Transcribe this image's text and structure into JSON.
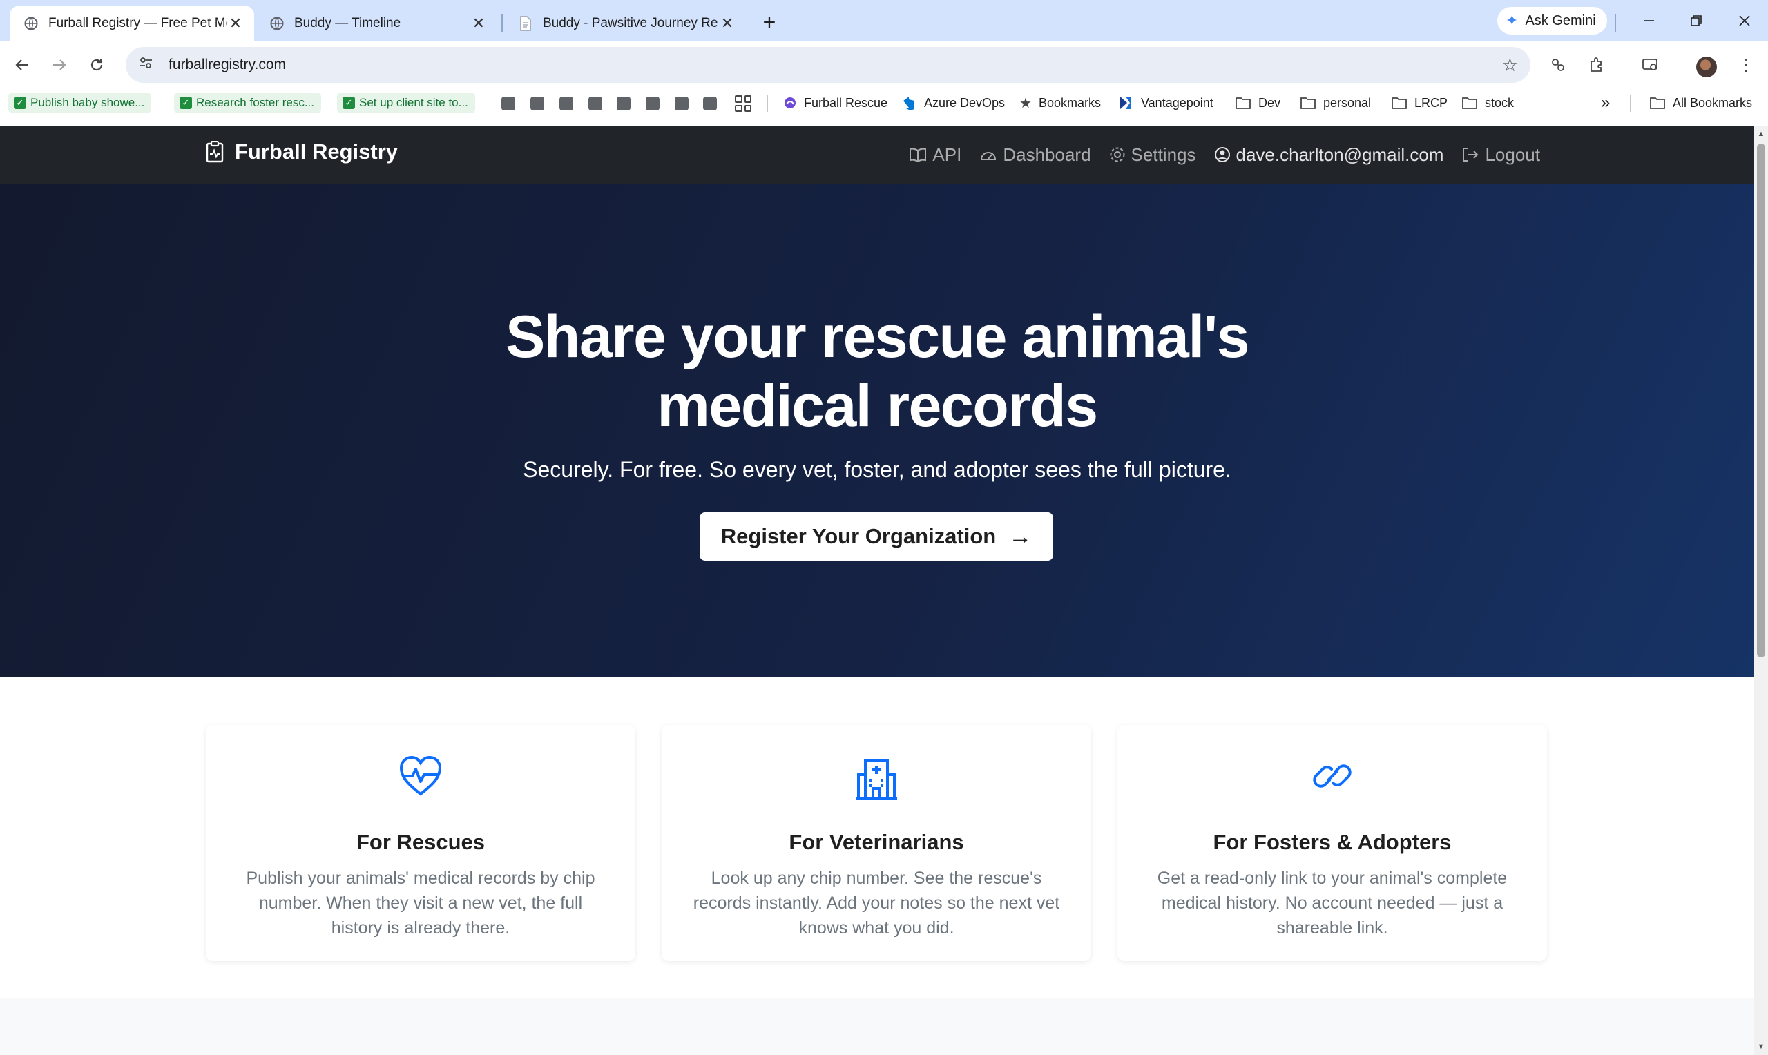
{
  "browser": {
    "tabs": [
      {
        "title": "Furball Registry — Free Pet Me",
        "icon": "globe-icon"
      },
      {
        "title": "Buddy — Timeline",
        "icon": "globe-icon"
      },
      {
        "title": "Buddy - Pawsitive Journey Resc",
        "icon": "document-icon"
      }
    ],
    "ask_gemini": "Ask Gemini",
    "url": "furballregistry.com",
    "bookmarks": {
      "todos": [
        "Publish baby showe...",
        "Research foster resc...",
        "Set up client site to..."
      ],
      "items": [
        "Furball Rescue",
        "Azure DevOps",
        "Bookmarks",
        "Vantagepoint",
        "Dev",
        "personal",
        "LRCP",
        "stock"
      ],
      "all_bookmarks": "All Bookmarks"
    }
  },
  "site": {
    "brand": "Furball Registry",
    "nav": {
      "api": "API",
      "dashboard": "Dashboard",
      "settings": "Settings",
      "user": "dave.charlton@gmail.com",
      "logout": "Logout"
    }
  },
  "hero": {
    "title_line1": "Share your rescue animal's",
    "title_line2": "medical records",
    "subtitle": "Securely. For free. So every vet, foster, and adopter sees the full picture.",
    "cta": "Register Your Organization"
  },
  "features": [
    {
      "icon": "heart-pulse-icon",
      "title": "For Rescues",
      "text": "Publish your animals' medical records by chip number. When they visit a new vet, the full history is already there."
    },
    {
      "icon": "hospital-icon",
      "title": "For Veterinarians",
      "text": "Look up any chip number. See the rescue's records instantly. Add your notes so the next vet knows what you did."
    },
    {
      "icon": "link-icon",
      "title": "For Fosters & Adopters",
      "text": "Get a read-only link to your animal's complete medical history. No account needed — just a shareable link."
    }
  ],
  "colors": {
    "accent": "#0d6efd",
    "navbar": "#212529",
    "hero_start": "#131a2f",
    "hero_end": "#163366"
  }
}
